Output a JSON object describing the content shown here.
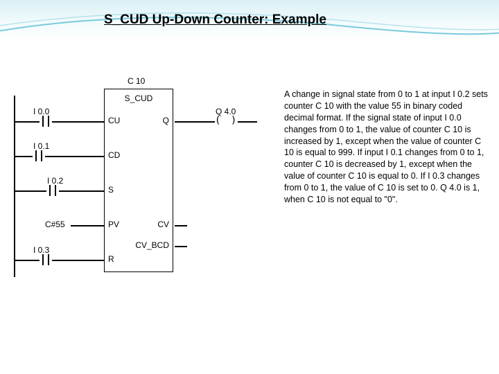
{
  "title": "S_CUD Up-Down Counter: Example",
  "block": {
    "name": "C 10",
    "type": "S_CUD",
    "inputs": {
      "cu": "CU",
      "cd": "CD",
      "s": "S",
      "pv": "PV",
      "r": "R"
    },
    "outputs": {
      "q": "Q",
      "cv": "CV",
      "cv_bcd": "CV_BCD"
    }
  },
  "signals": {
    "i00": "I 0.0",
    "i01": "I 0.1",
    "i02": "I 0.2",
    "pv_val": "C#55",
    "i03": "I 0.3",
    "q40": "Q 4.0"
  },
  "description": "A change in signal state from 0 to 1 at input I 0.2 sets counter C 10 with the value 55 in binary coded decimal format. If the signal state of input I 0.0 changes from 0 to 1, the value of counter C 10 is increased by 1, except when the value of counter C 10 is equal to 999. If input I 0.1 changes from 0 to 1, counter C 10 is decreased by 1, except when the value of counter C 10 is equal to 0. If I 0.3 changes from 0 to 1, the value of C 10 is set to 0. Q 4.0 is 1, when C 10 is not equal to \"0\"."
}
